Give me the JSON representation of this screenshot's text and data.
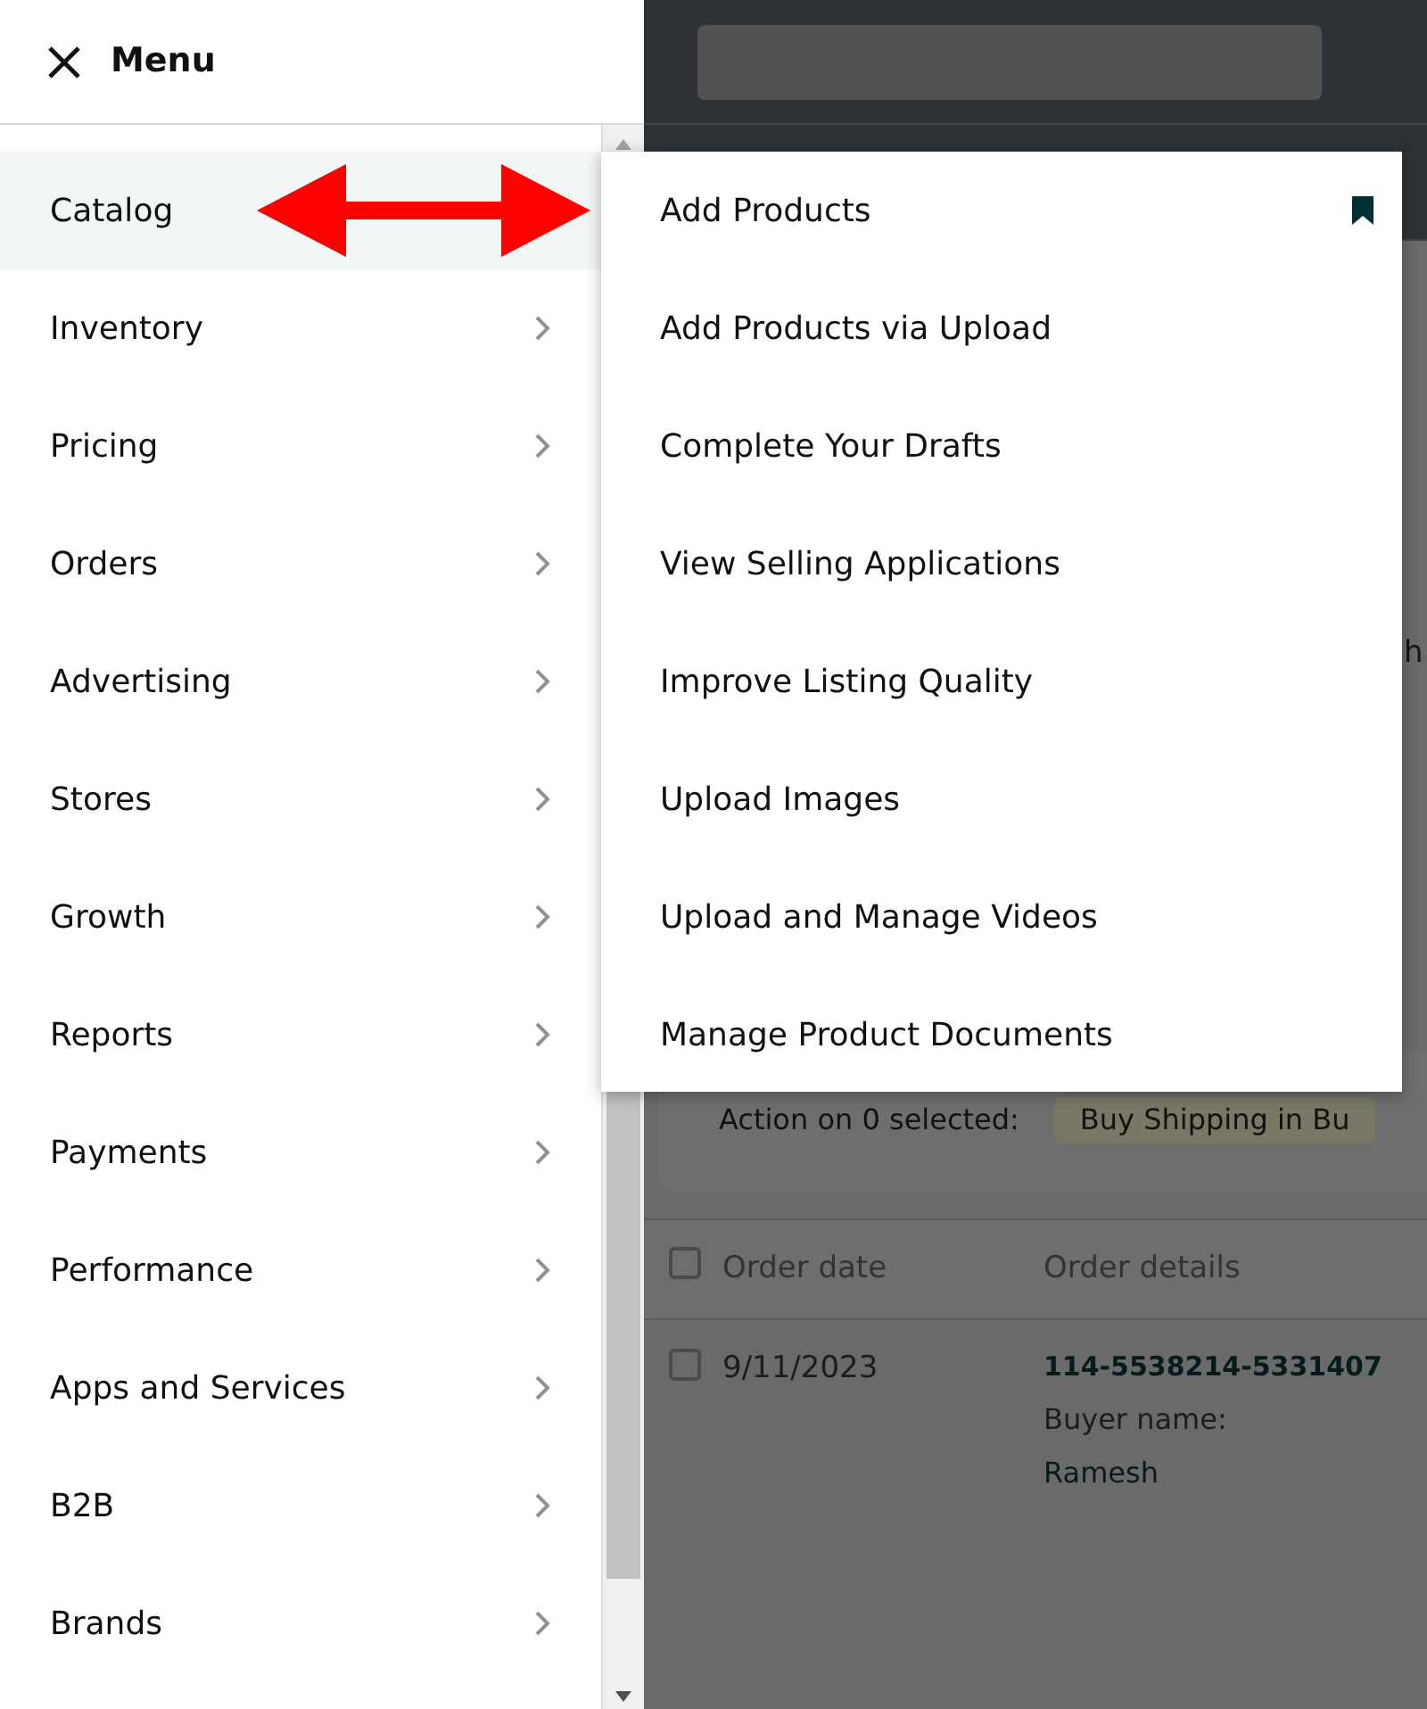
{
  "menu": {
    "title": "Menu",
    "items": [
      {
        "label": "Catalog",
        "selected": true
      },
      {
        "label": "Inventory",
        "selected": false
      },
      {
        "label": "Pricing",
        "selected": false
      },
      {
        "label": "Orders",
        "selected": false
      },
      {
        "label": "Advertising",
        "selected": false
      },
      {
        "label": "Stores",
        "selected": false
      },
      {
        "label": "Growth",
        "selected": false
      },
      {
        "label": "Reports",
        "selected": false
      },
      {
        "label": "Payments",
        "selected": false
      },
      {
        "label": "Performance",
        "selected": false
      },
      {
        "label": "Apps and Services",
        "selected": false
      },
      {
        "label": "B2B",
        "selected": false
      },
      {
        "label": "Brands",
        "selected": false
      }
    ]
  },
  "submenu": {
    "items": [
      {
        "label": "Add Products",
        "bookmarked": true
      },
      {
        "label": "Add Products via Upload",
        "bookmarked": false
      },
      {
        "label": "Complete Your Drafts",
        "bookmarked": false
      },
      {
        "label": "View Selling Applications",
        "bookmarked": false
      },
      {
        "label": "Improve Listing Quality",
        "bookmarked": false
      },
      {
        "label": "Upload Images",
        "bookmarked": false
      },
      {
        "label": "Upload and Manage Videos",
        "bookmarked": false
      },
      {
        "label": "Manage Product Documents",
        "bookmarked": false
      }
    ]
  },
  "background": {
    "partial_tab": "h",
    "actions": {
      "label": "Action on 0 selected:",
      "button": "Buy Shipping in Bu"
    },
    "table": {
      "header_checked": false,
      "columns": [
        "Order date",
        "Order details"
      ],
      "rows": [
        {
          "checked": false,
          "date": "9/11/2023",
          "order_id": "114-5538214-5331407",
          "buyer_label": "Buyer name:",
          "buyer_name": "Ramesh"
        }
      ]
    }
  }
}
